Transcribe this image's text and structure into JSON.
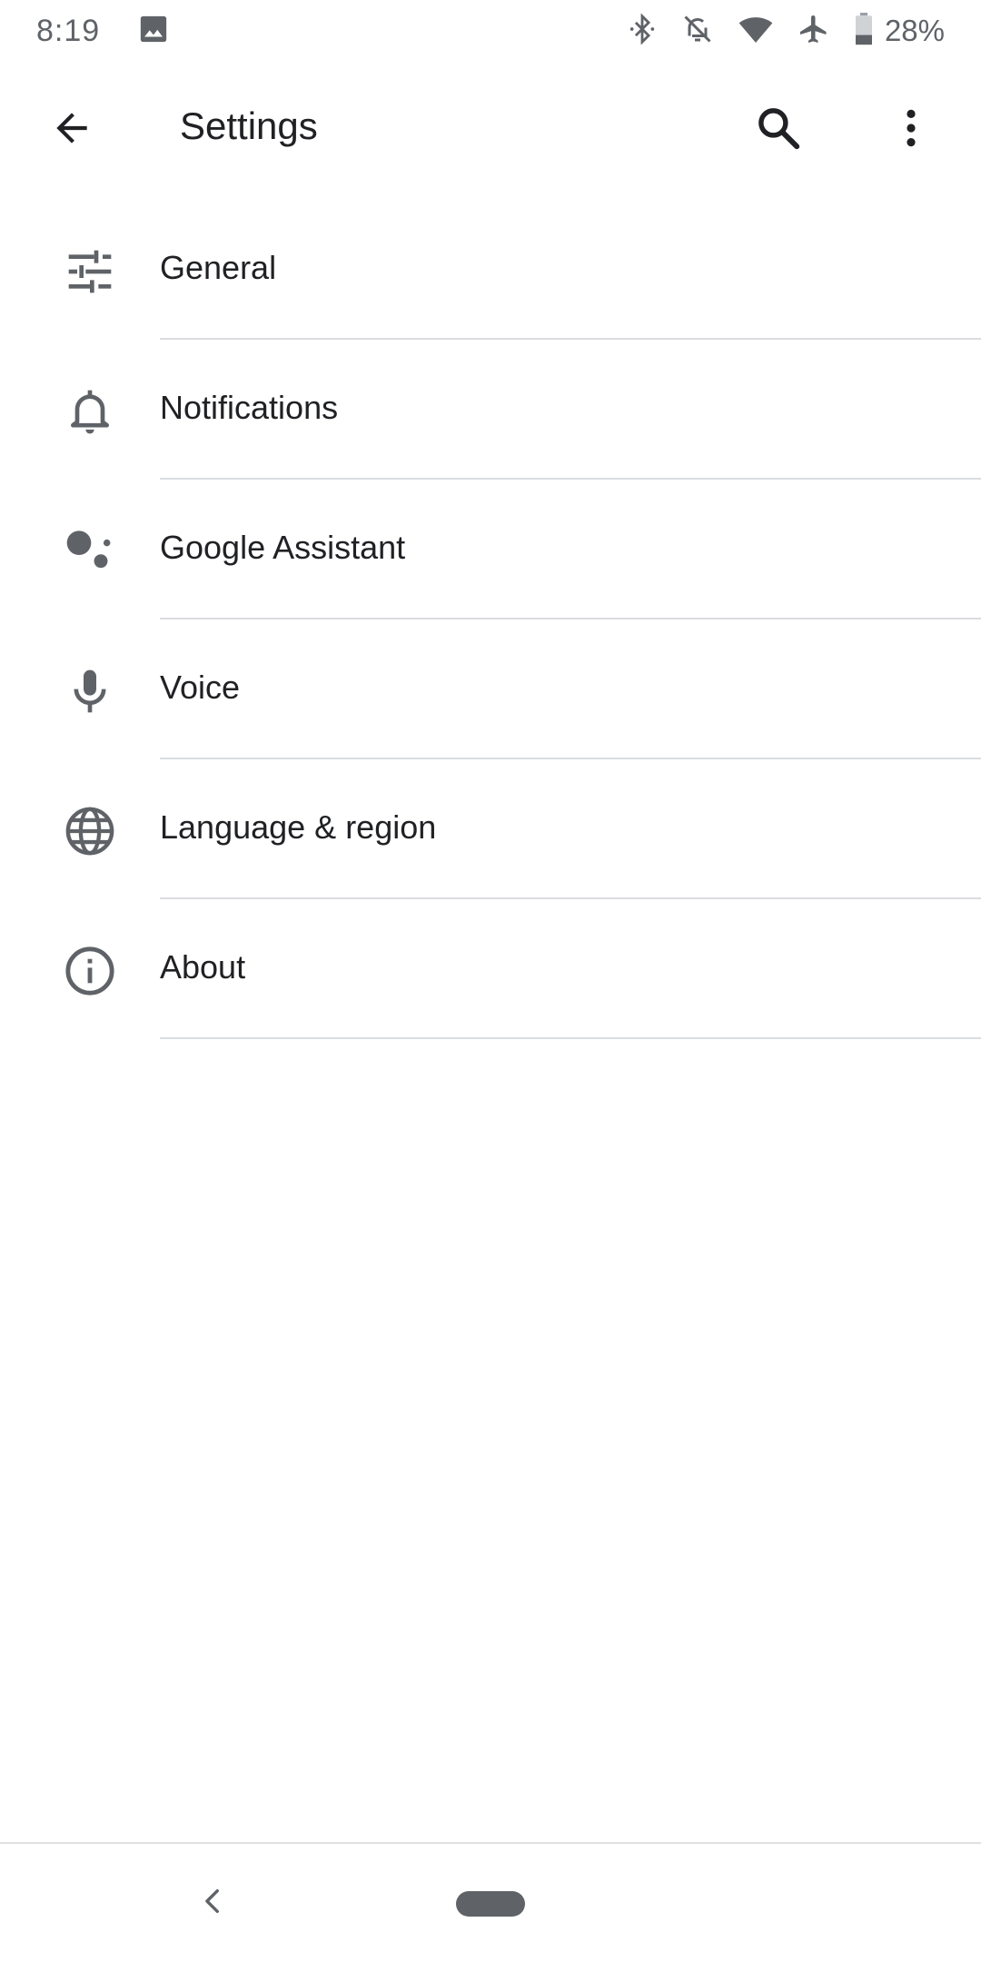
{
  "status_bar": {
    "time": "8:19",
    "battery_percent": "28%",
    "icons": [
      "image-icon",
      "bluetooth-icon",
      "notifications-off-icon",
      "wifi-icon",
      "airplane-mode-icon",
      "battery-icon"
    ]
  },
  "app_bar": {
    "title": "Settings",
    "back_icon": "arrow-back-icon",
    "search_icon": "search-icon",
    "more_icon": "more-vert-icon"
  },
  "settings": {
    "items": [
      {
        "label": "General",
        "icon": "tune-icon"
      },
      {
        "label": "Notifications",
        "icon": "bell-icon"
      },
      {
        "label": "Google Assistant",
        "icon": "assistant-icon"
      },
      {
        "label": "Voice",
        "icon": "mic-icon"
      },
      {
        "label": "Language & region",
        "icon": "globe-icon"
      },
      {
        "label": "About",
        "icon": "info-icon"
      }
    ]
  },
  "nav_bar": {
    "back_icon": "nav-back-icon",
    "home_icon": "home-pill"
  },
  "colors": {
    "icon": "#5f6368",
    "text": "#202124",
    "divider": "#dadce0",
    "background": "#ffffff"
  }
}
